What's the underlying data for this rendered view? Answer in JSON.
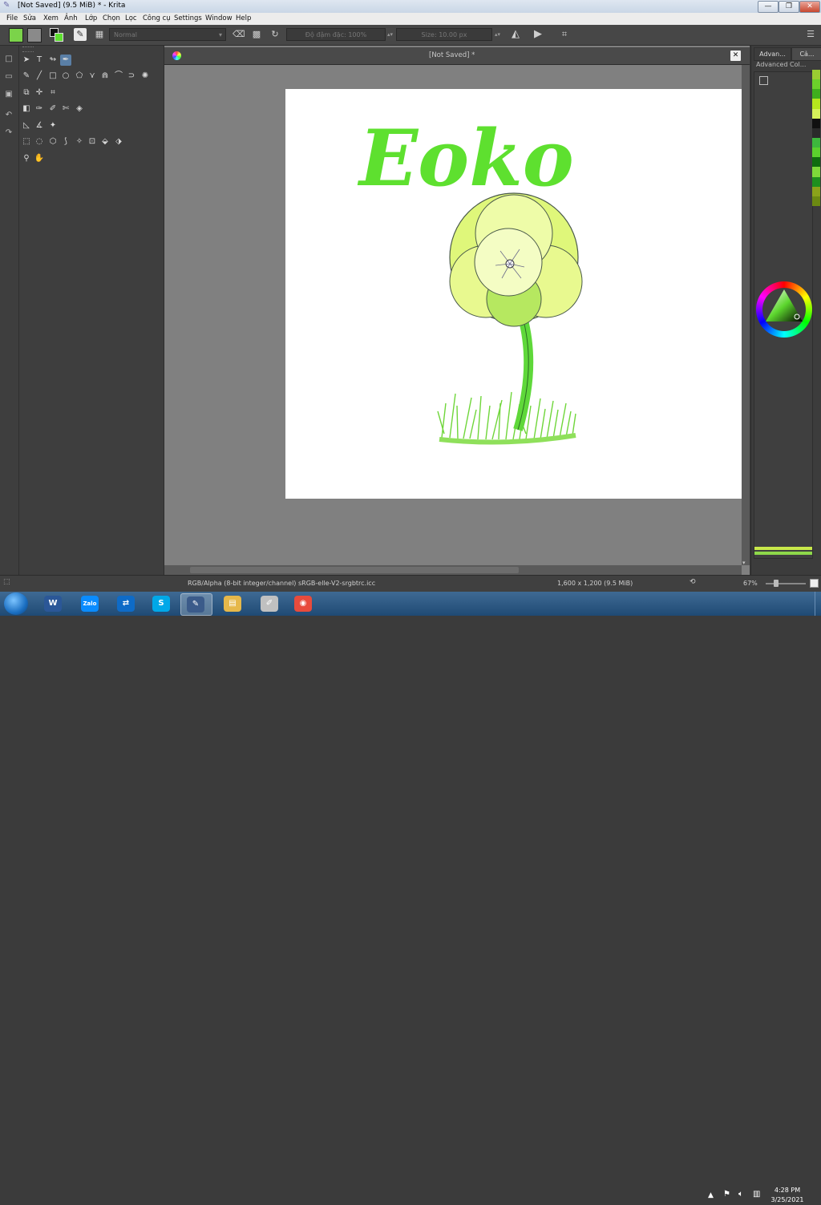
{
  "window": {
    "title": "[Not Saved]  (9.5 MiB)  * - Krita",
    "minimize_glyph": "—",
    "maximize_glyph": "❐",
    "close_glyph": "✕"
  },
  "menu": [
    "File",
    "Sửa",
    "Xem",
    "Ảnh",
    "Lớp",
    "Chọn",
    "Lọc",
    "Công cụ",
    "Settings",
    "Window",
    "Help"
  ],
  "toolbar": {
    "blend_mode": "Normal",
    "opacity_label": "Độ đậm đặc: 100%",
    "size_label": "Size: 10.00 px",
    "fg_color": "#7bd34a",
    "bg_color": "#8a8a8a"
  },
  "document": {
    "tab_title": "[Not Saved]  *",
    "close_glyph": "✕",
    "artwork_text": "Eoko",
    "artwork_color": "#5ee02f"
  },
  "dockers": {
    "tab1": "Advan...",
    "tab2": "Cả...",
    "panel_title": "Advanced Col..."
  },
  "palette_colors": [
    "#9acd32",
    "#6ccf2b",
    "#3fae1d",
    "#b5e61d",
    "#d6f25a",
    "#101010",
    "#2a2a2a",
    "#3db83d",
    "#5bd12d",
    "#0f6d0f",
    "#7fd93a",
    "#1e8f1e",
    "#8aa31a",
    "#6c8a12"
  ],
  "status": {
    "color_space": "RGB/Alpha (8-bit integer/channel)  sRGB-elle-V2-srgbtrc.icc",
    "dimensions": "1,600 x 1,200 (9.5 MiB)",
    "zoom": "67%"
  },
  "taskbar": {
    "apps": [
      {
        "name": "word",
        "glyph": "W",
        "color": "#2b5797"
      },
      {
        "name": "zalo",
        "glyph": "Zalo",
        "color": "#0a8cff"
      },
      {
        "name": "teamviewer",
        "glyph": "⇄",
        "color": "#0e6bc7"
      },
      {
        "name": "skype",
        "glyph": "S",
        "color": "#00a8e8"
      },
      {
        "name": "krita",
        "glyph": "✎",
        "color": "#3b5b8a"
      },
      {
        "name": "explorer",
        "glyph": "▤",
        "color": "#e6b84a"
      },
      {
        "name": "paint",
        "glyph": "✐",
        "color": "#c0c0c0"
      },
      {
        "name": "chrome",
        "glyph": "◉",
        "color": "#e84b3c"
      }
    ],
    "time": "4:28 PM",
    "date": "3/25/2021"
  }
}
